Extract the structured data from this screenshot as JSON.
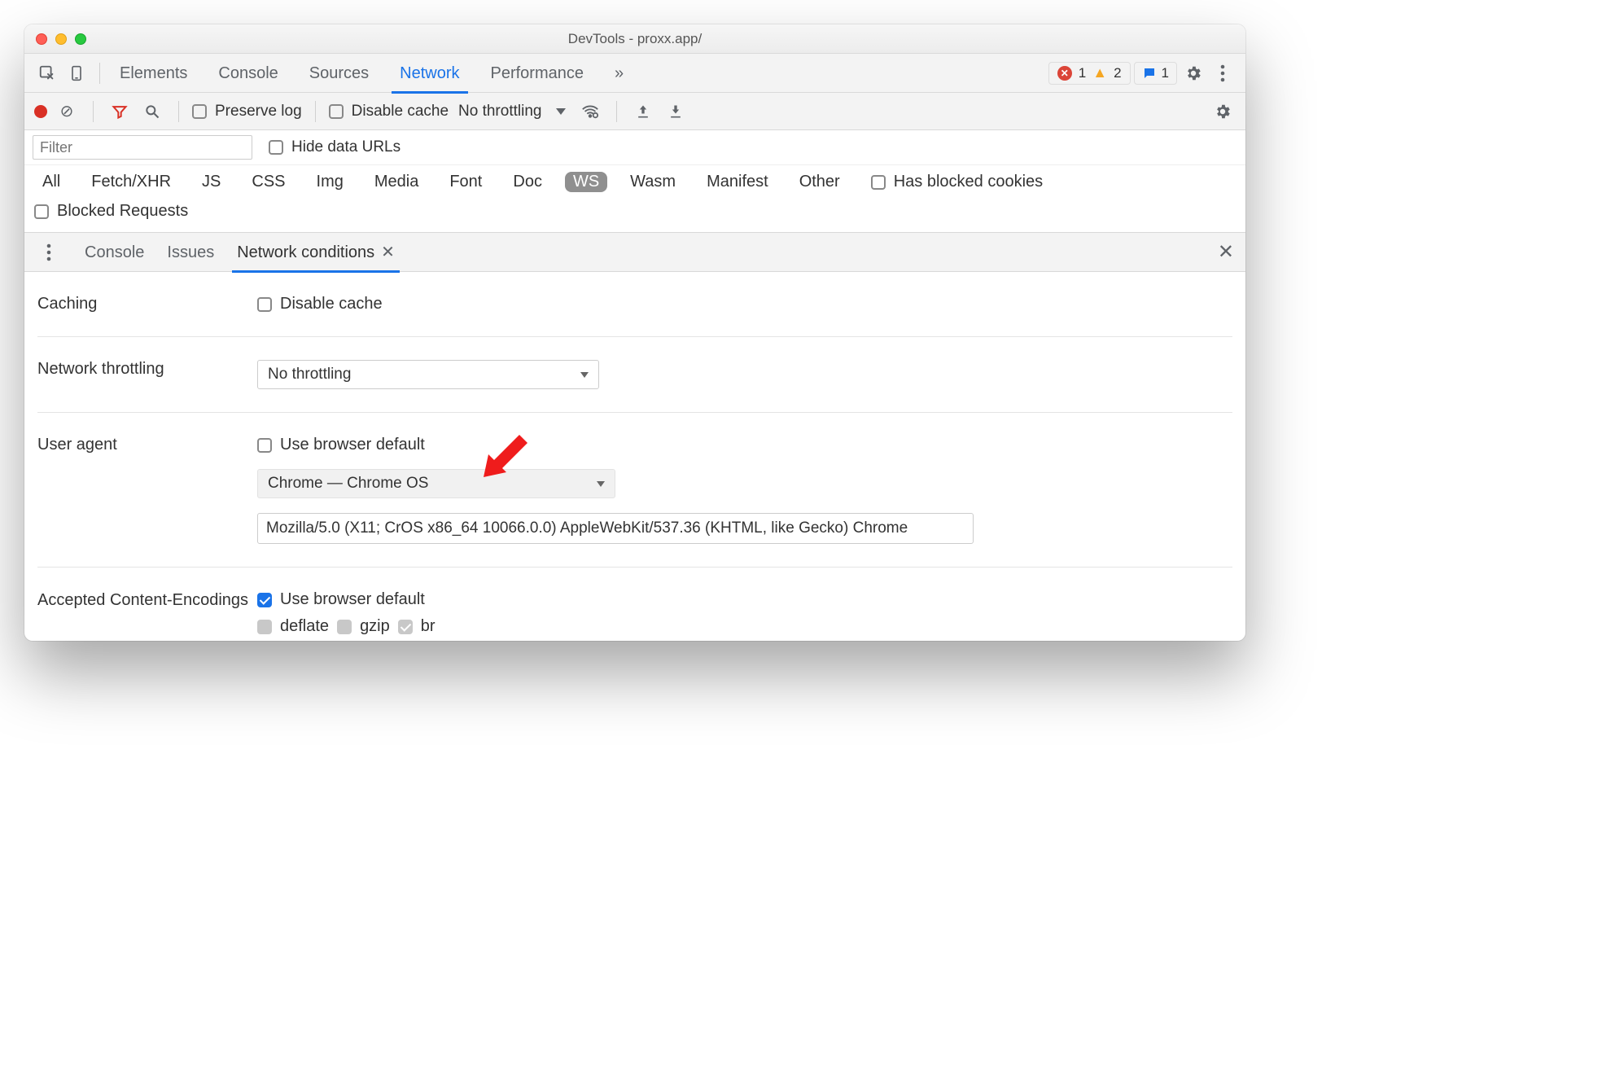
{
  "window": {
    "title": "DevTools - proxx.app/"
  },
  "main_tabs": {
    "elements": "Elements",
    "console": "Console",
    "sources": "Sources",
    "network": "Network",
    "performance": "Performance",
    "more": "»"
  },
  "status": {
    "errors": "1",
    "warnings": "2",
    "messages": "1"
  },
  "net_toolbar": {
    "preserve_log": "Preserve log",
    "disable_cache": "Disable cache",
    "throttling": "No throttling"
  },
  "filter": {
    "placeholder": "Filter",
    "hide_data_urls": "Hide data URLs"
  },
  "type_filters": {
    "all": "All",
    "fetch": "Fetch/XHR",
    "js": "JS",
    "css": "CSS",
    "img": "Img",
    "media": "Media",
    "font": "Font",
    "doc": "Doc",
    "ws": "WS",
    "wasm": "Wasm",
    "manifest": "Manifest",
    "other": "Other",
    "has_blocked_cookies": "Has blocked cookies",
    "blocked_requests": "Blocked Requests"
  },
  "drawer_tabs": {
    "console": "Console",
    "issues": "Issues",
    "network_conditions": "Network conditions"
  },
  "panel": {
    "caching_label": "Caching",
    "caching_disable": "Disable cache",
    "throttling_label": "Network throttling",
    "throttling_value": "No throttling",
    "ua_label": "User agent",
    "ua_default": "Use browser default",
    "ua_select": "Chrome — Chrome OS",
    "ua_string": "Mozilla/5.0 (X11; CrOS x86_64 10066.0.0) AppleWebKit/537.36 (KHTML, like Gecko) Chrome",
    "enc_label": "Accepted Content-Encodings",
    "enc_default": "Use browser default",
    "enc_deflate": "deflate",
    "enc_gzip": "gzip",
    "enc_br": "br"
  }
}
